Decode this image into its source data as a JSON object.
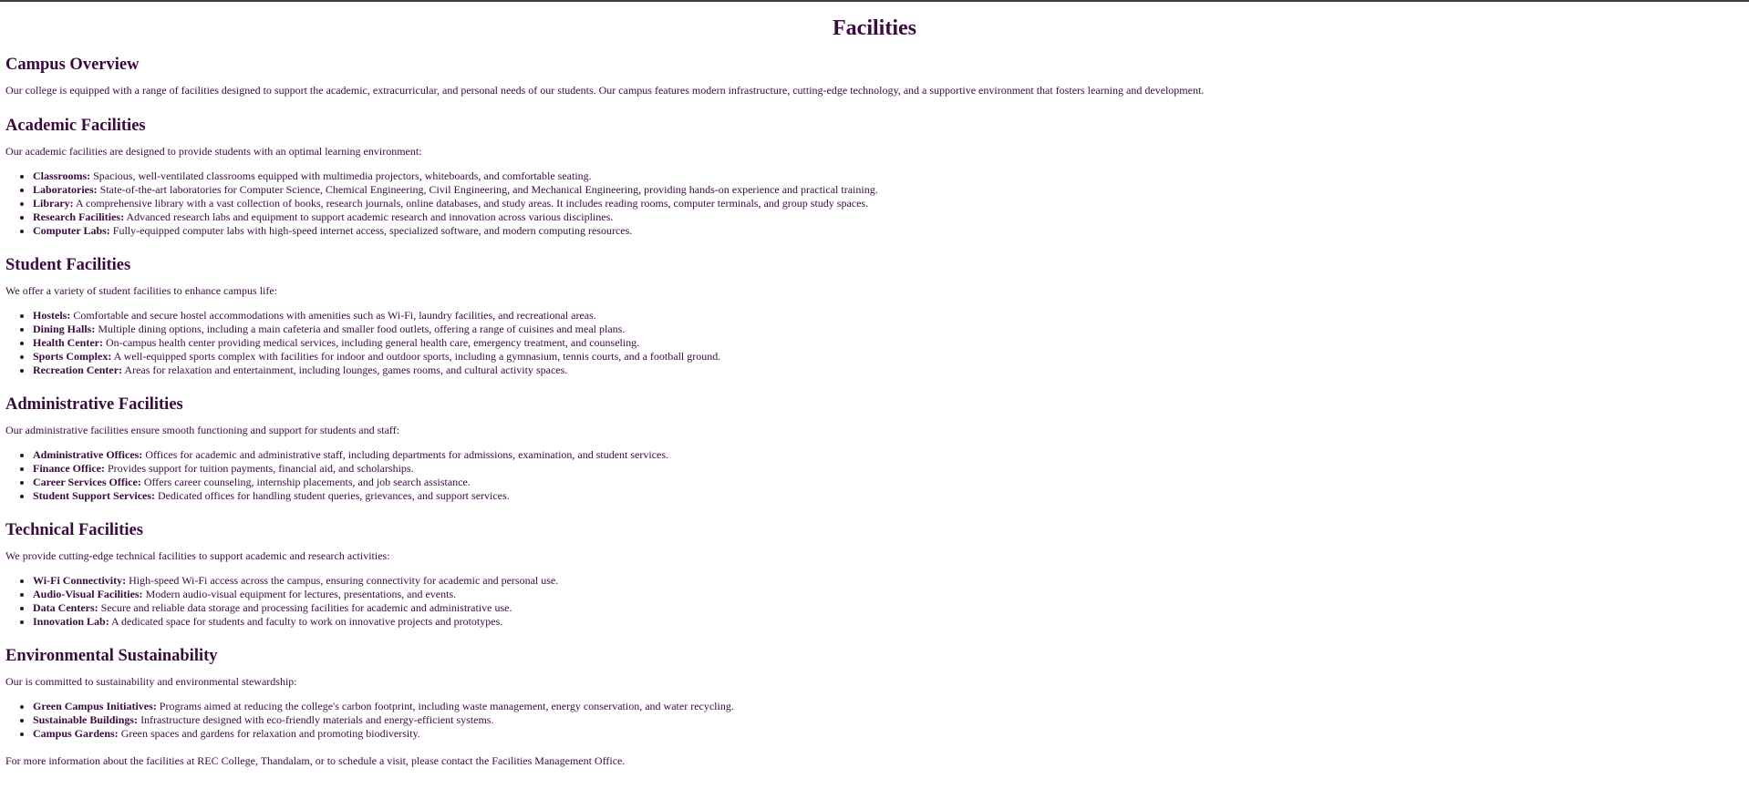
{
  "page": {
    "title": "Facilities"
  },
  "sections": {
    "overview": {
      "heading": "Campus Overview",
      "intro": "Our college is equipped with a range of facilities designed to support the academic, extracurricular, and personal needs of our students. Our campus features modern infrastructure, cutting-edge technology, and a supportive environment that fosters learning and development."
    },
    "academic": {
      "heading": "Academic Facilities",
      "intro": "Our academic facilities are designed to provide students with an optimal learning environment:",
      "items": [
        {
          "term": "Classrooms:",
          "text": " Spacious, well-ventilated classrooms equipped with multimedia projectors, whiteboards, and comfortable seating."
        },
        {
          "term": "Laboratories:",
          "text": " State-of-the-art laboratories for Computer Science, Chemical Engineering, Civil Engineering, and Mechanical Engineering, providing hands-on experience and practical training."
        },
        {
          "term": "Library:",
          "text": " A comprehensive library with a vast collection of books, research journals, online databases, and study areas. It includes reading rooms, computer terminals, and group study spaces."
        },
        {
          "term": "Research Facilities:",
          "text": " Advanced research labs and equipment to support academic research and innovation across various disciplines."
        },
        {
          "term": "Computer Labs:",
          "text": " Fully-equipped computer labs with high-speed internet access, specialized software, and modern computing resources."
        }
      ]
    },
    "student": {
      "heading": "Student Facilities",
      "intro": "We offer a variety of student facilities to enhance campus life:",
      "items": [
        {
          "term": "Hostels:",
          "text": " Comfortable and secure hostel accommodations with amenities such as Wi-Fi, laundry facilities, and recreational areas."
        },
        {
          "term": "Dining Halls:",
          "text": " Multiple dining options, including a main cafeteria and smaller food outlets, offering a range of cuisines and meal plans."
        },
        {
          "term": "Health Center:",
          "text": " On-campus health center providing medical services, including general health care, emergency treatment, and counseling."
        },
        {
          "term": "Sports Complex:",
          "text": " A well-equipped sports complex with facilities for indoor and outdoor sports, including a gymnasium, tennis courts, and a football ground."
        },
        {
          "term": "Recreation Center:",
          "text": " Areas for relaxation and entertainment, including lounges, games rooms, and cultural activity spaces."
        }
      ]
    },
    "administrative": {
      "heading": "Administrative Facilities",
      "intro": "Our administrative facilities ensure smooth functioning and support for students and staff:",
      "items": [
        {
          "term": "Administrative Offices:",
          "text": " Offices for academic and administrative staff, including departments for admissions, examination, and student services."
        },
        {
          "term": "Finance Office:",
          "text": " Provides support for tuition payments, financial aid, and scholarships."
        },
        {
          "term": "Career Services Office:",
          "text": " Offers career counseling, internship placements, and job search assistance."
        },
        {
          "term": "Student Support Services:",
          "text": " Dedicated offices for handling student queries, grievances, and support services."
        }
      ]
    },
    "technical": {
      "heading": "Technical Facilities",
      "intro": "We provide cutting-edge technical facilities to support academic and research activities:",
      "items": [
        {
          "term": "Wi-Fi Connectivity:",
          "text": " High-speed Wi-Fi access across the campus, ensuring connectivity for academic and personal use."
        },
        {
          "term": "Audio-Visual Facilities:",
          "text": " Modern audio-visual equipment for lectures, presentations, and events."
        },
        {
          "term": "Data Centers:",
          "text": " Secure and reliable data storage and processing facilities for academic and administrative use."
        },
        {
          "term": "Innovation Lab:",
          "text": " A dedicated space for students and faculty to work on innovative projects and prototypes."
        }
      ]
    },
    "environment": {
      "heading": "Environmental Sustainability",
      "intro": "Our is committed to sustainability and environmental stewardship:",
      "items": [
        {
          "term": "Green Campus Initiatives:",
          "text": " Programs aimed at reducing the college's carbon footprint, including waste management, energy conservation, and water recycling."
        },
        {
          "term": "Sustainable Buildings:",
          "text": " Infrastructure designed with eco-friendly materials and energy-efficient systems."
        },
        {
          "term": "Campus Gardens:",
          "text": " Green spaces and gardens for relaxation and promoting biodiversity."
        }
      ]
    }
  },
  "footer": {
    "note": "For more information about the facilities at REC College, Thandalam, or to schedule a visit, please contact the Facilities Management Office."
  },
  "colors": {
    "text": "#3a0a3f",
    "top_bar": "#3b3f46",
    "background": "#ffffff"
  }
}
